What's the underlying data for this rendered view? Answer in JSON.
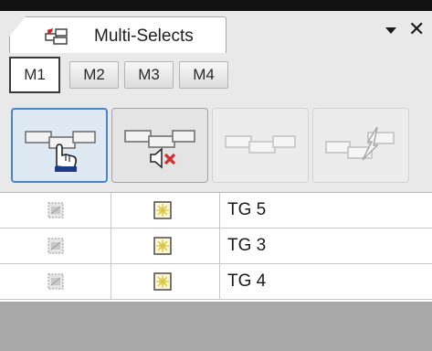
{
  "panel": {
    "title": "Multi-Selects",
    "icons": {
      "tab": "multi-select-icon",
      "dropdown": "dropdown-arrow-icon",
      "close": "close-icon"
    },
    "close_glyph": "✕"
  },
  "memory_tabs": [
    {
      "label": "M1",
      "active": true
    },
    {
      "label": "M2",
      "active": false
    },
    {
      "label": "M3",
      "active": false
    },
    {
      "label": "M4",
      "active": false
    }
  ],
  "toolbar": {
    "buttons": [
      {
        "name": "select-bars-icon",
        "state": "selected"
      },
      {
        "name": "remove-selection-icon",
        "state": "enabled"
      },
      {
        "name": "link-bars-icon",
        "state": "disabled"
      },
      {
        "name": "unlink-bars-icon",
        "state": "disabled"
      }
    ]
  },
  "rows": [
    {
      "label": "TG 5",
      "icon1": "grey-selection-icon",
      "icon2": "yellow-star-icon"
    },
    {
      "label": "TG 3",
      "icon1": "grey-selection-icon",
      "icon2": "yellow-star-icon"
    },
    {
      "label": "TG 4",
      "icon1": "grey-selection-icon",
      "icon2": "yellow-star-icon"
    }
  ],
  "colors": {
    "panel_background": "#e9e9e9",
    "selected_border": "#4a86c5",
    "empty_area": "#a8a8a8",
    "remove_icon": "#d32f2f",
    "star_icon": "#f5e27a"
  }
}
